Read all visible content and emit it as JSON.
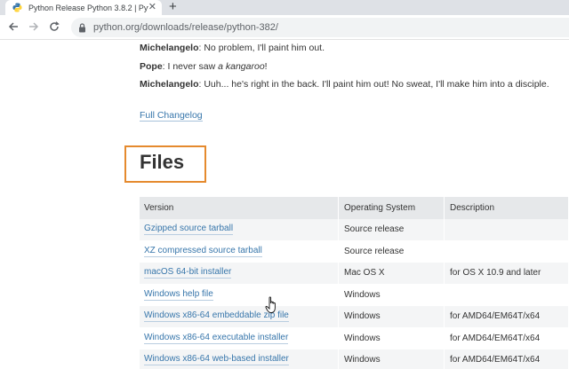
{
  "browser": {
    "tab_title": "Python Release Python 3.8.2 | Pyt",
    "tab_close": "✕",
    "new_tab": "+",
    "url": "python.org/downloads/release/python-382/"
  },
  "dialogue": [
    {
      "speaker": "Michelangelo",
      "text": ": No problem, I'll paint him out."
    },
    {
      "speaker": "Pope",
      "text_before": ": I never saw ",
      "italic": "a kangaroo",
      "text_after": "!"
    },
    {
      "speaker": "Michelangelo",
      "text": ": Uuh... he's right in the back. I'll paint him out! No sweat, I'll make him into a disciple."
    }
  ],
  "changelog_link": "Full Changelog",
  "files_heading": "Files",
  "table": {
    "headers": [
      "Version",
      "Operating System",
      "Description"
    ],
    "rows": [
      {
        "version": "Gzipped source tarball",
        "os": "Source release",
        "description": ""
      },
      {
        "version": "XZ compressed source tarball",
        "os": "Source release",
        "description": ""
      },
      {
        "version": "macOS 64-bit installer",
        "os": "Mac OS X",
        "description": "for OS X 10.9 and later"
      },
      {
        "version": "Windows help file",
        "os": "Windows",
        "description": ""
      },
      {
        "version": "Windows x86-64 embeddable zip file",
        "os": "Windows",
        "description": "for AMD64/EM64T/x64"
      },
      {
        "version": "Windows x86-64 executable installer",
        "os": "Windows",
        "description": "for AMD64/EM64T/x64"
      },
      {
        "version": "Windows x86-64 web-based installer",
        "os": "Windows",
        "description": "for AMD64/EM64T/x64"
      }
    ]
  },
  "colors": {
    "link": "#3776ab",
    "highlight_box": "#e58a2e",
    "table_header_bg": "#e6e8ea"
  },
  "icons": [
    "python-favicon-icon",
    "close-icon",
    "new-tab-icon",
    "back-arrow-icon",
    "forward-arrow-icon",
    "reload-icon",
    "lock-icon",
    "hand-cursor-icon"
  ]
}
